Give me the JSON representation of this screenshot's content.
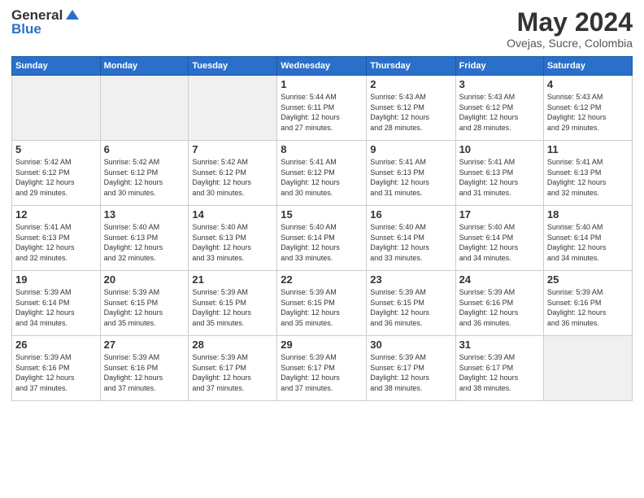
{
  "logo": {
    "text1": "General",
    "text2": "Blue"
  },
  "title": "May 2024",
  "location": "Ovejas, Sucre, Colombia",
  "days_of_week": [
    "Sunday",
    "Monday",
    "Tuesday",
    "Wednesday",
    "Thursday",
    "Friday",
    "Saturday"
  ],
  "weeks": [
    [
      {
        "day": "",
        "info": ""
      },
      {
        "day": "",
        "info": ""
      },
      {
        "day": "",
        "info": ""
      },
      {
        "day": "1",
        "info": "Sunrise: 5:44 AM\nSunset: 6:11 PM\nDaylight: 12 hours\nand 27 minutes."
      },
      {
        "day": "2",
        "info": "Sunrise: 5:43 AM\nSunset: 6:12 PM\nDaylight: 12 hours\nand 28 minutes."
      },
      {
        "day": "3",
        "info": "Sunrise: 5:43 AM\nSunset: 6:12 PM\nDaylight: 12 hours\nand 28 minutes."
      },
      {
        "day": "4",
        "info": "Sunrise: 5:43 AM\nSunset: 6:12 PM\nDaylight: 12 hours\nand 29 minutes."
      }
    ],
    [
      {
        "day": "5",
        "info": "Sunrise: 5:42 AM\nSunset: 6:12 PM\nDaylight: 12 hours\nand 29 minutes."
      },
      {
        "day": "6",
        "info": "Sunrise: 5:42 AM\nSunset: 6:12 PM\nDaylight: 12 hours\nand 30 minutes."
      },
      {
        "day": "7",
        "info": "Sunrise: 5:42 AM\nSunset: 6:12 PM\nDaylight: 12 hours\nand 30 minutes."
      },
      {
        "day": "8",
        "info": "Sunrise: 5:41 AM\nSunset: 6:12 PM\nDaylight: 12 hours\nand 30 minutes."
      },
      {
        "day": "9",
        "info": "Sunrise: 5:41 AM\nSunset: 6:13 PM\nDaylight: 12 hours\nand 31 minutes."
      },
      {
        "day": "10",
        "info": "Sunrise: 5:41 AM\nSunset: 6:13 PM\nDaylight: 12 hours\nand 31 minutes."
      },
      {
        "day": "11",
        "info": "Sunrise: 5:41 AM\nSunset: 6:13 PM\nDaylight: 12 hours\nand 32 minutes."
      }
    ],
    [
      {
        "day": "12",
        "info": "Sunrise: 5:41 AM\nSunset: 6:13 PM\nDaylight: 12 hours\nand 32 minutes."
      },
      {
        "day": "13",
        "info": "Sunrise: 5:40 AM\nSunset: 6:13 PM\nDaylight: 12 hours\nand 32 minutes."
      },
      {
        "day": "14",
        "info": "Sunrise: 5:40 AM\nSunset: 6:13 PM\nDaylight: 12 hours\nand 33 minutes."
      },
      {
        "day": "15",
        "info": "Sunrise: 5:40 AM\nSunset: 6:14 PM\nDaylight: 12 hours\nand 33 minutes."
      },
      {
        "day": "16",
        "info": "Sunrise: 5:40 AM\nSunset: 6:14 PM\nDaylight: 12 hours\nand 33 minutes."
      },
      {
        "day": "17",
        "info": "Sunrise: 5:40 AM\nSunset: 6:14 PM\nDaylight: 12 hours\nand 34 minutes."
      },
      {
        "day": "18",
        "info": "Sunrise: 5:40 AM\nSunset: 6:14 PM\nDaylight: 12 hours\nand 34 minutes."
      }
    ],
    [
      {
        "day": "19",
        "info": "Sunrise: 5:39 AM\nSunset: 6:14 PM\nDaylight: 12 hours\nand 34 minutes."
      },
      {
        "day": "20",
        "info": "Sunrise: 5:39 AM\nSunset: 6:15 PM\nDaylight: 12 hours\nand 35 minutes."
      },
      {
        "day": "21",
        "info": "Sunrise: 5:39 AM\nSunset: 6:15 PM\nDaylight: 12 hours\nand 35 minutes."
      },
      {
        "day": "22",
        "info": "Sunrise: 5:39 AM\nSunset: 6:15 PM\nDaylight: 12 hours\nand 35 minutes."
      },
      {
        "day": "23",
        "info": "Sunrise: 5:39 AM\nSunset: 6:15 PM\nDaylight: 12 hours\nand 36 minutes."
      },
      {
        "day": "24",
        "info": "Sunrise: 5:39 AM\nSunset: 6:16 PM\nDaylight: 12 hours\nand 36 minutes."
      },
      {
        "day": "25",
        "info": "Sunrise: 5:39 AM\nSunset: 6:16 PM\nDaylight: 12 hours\nand 36 minutes."
      }
    ],
    [
      {
        "day": "26",
        "info": "Sunrise: 5:39 AM\nSunset: 6:16 PM\nDaylight: 12 hours\nand 37 minutes."
      },
      {
        "day": "27",
        "info": "Sunrise: 5:39 AM\nSunset: 6:16 PM\nDaylight: 12 hours\nand 37 minutes."
      },
      {
        "day": "28",
        "info": "Sunrise: 5:39 AM\nSunset: 6:17 PM\nDaylight: 12 hours\nand 37 minutes."
      },
      {
        "day": "29",
        "info": "Sunrise: 5:39 AM\nSunset: 6:17 PM\nDaylight: 12 hours\nand 37 minutes."
      },
      {
        "day": "30",
        "info": "Sunrise: 5:39 AM\nSunset: 6:17 PM\nDaylight: 12 hours\nand 38 minutes."
      },
      {
        "day": "31",
        "info": "Sunrise: 5:39 AM\nSunset: 6:17 PM\nDaylight: 12 hours\nand 38 minutes."
      },
      {
        "day": "",
        "info": ""
      }
    ]
  ]
}
